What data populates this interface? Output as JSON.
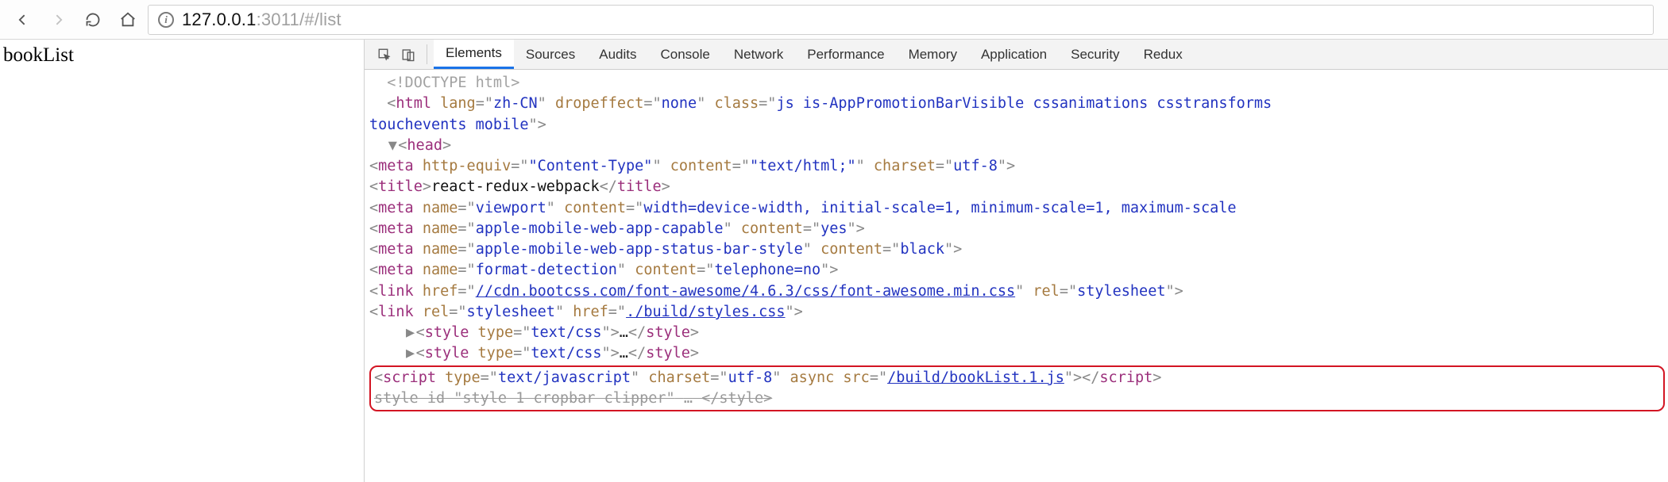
{
  "browser": {
    "url_host": "127.0.0.1",
    "url_port_path": ":3011/#/list"
  },
  "page": {
    "heading": "bookList"
  },
  "devtools": {
    "tabs": [
      "Elements",
      "Sources",
      "Audits",
      "Console",
      "Network",
      "Performance",
      "Memory",
      "Application",
      "Security",
      "Redux"
    ],
    "active_tab": "Elements"
  },
  "code": {
    "doctype": "<!DOCTYPE html>",
    "html_open": {
      "tag": "html",
      "lang": "zh-CN",
      "dropeffect": "none",
      "class": "js  is-AppPromotionBarVisible cssanimations csstransforms",
      "class_cont": "touchevents mobile"
    },
    "head": "head",
    "meta1": {
      "attr1": "http-equiv",
      "val1": "\"Content-Type\"",
      "attr2": "content",
      "val2": "\"text/html;\"",
      "attr3": "charset",
      "val3": "utf-8"
    },
    "title_tag": "title",
    "title_text": "react-redux-webpack",
    "meta2": {
      "n": "viewport",
      "c": "width=device-width, initial-scale=1, minimum-scale=1, maximum-scale"
    },
    "meta3": {
      "n": "apple-mobile-web-app-capable",
      "c": "yes"
    },
    "meta4": {
      "n": "apple-mobile-web-app-status-bar-style",
      "c": "black"
    },
    "meta5": {
      "n": "format-detection",
      "c": "telephone=no"
    },
    "link1": {
      "href": "//cdn.bootcss.com/font-awesome/4.6.3/css/font-awesome.min.css",
      "rel": "stylesheet"
    },
    "link2": {
      "rel": "stylesheet",
      "href": "./build/styles.css"
    },
    "style_type": "text/css",
    "script": {
      "type": "text/javascript",
      "charset": "utf-8",
      "src": "/build/bookList.1.js"
    },
    "style_hidden": "style id \"style 1 cropbar clipper\"",
    "ellipsis": "…"
  }
}
